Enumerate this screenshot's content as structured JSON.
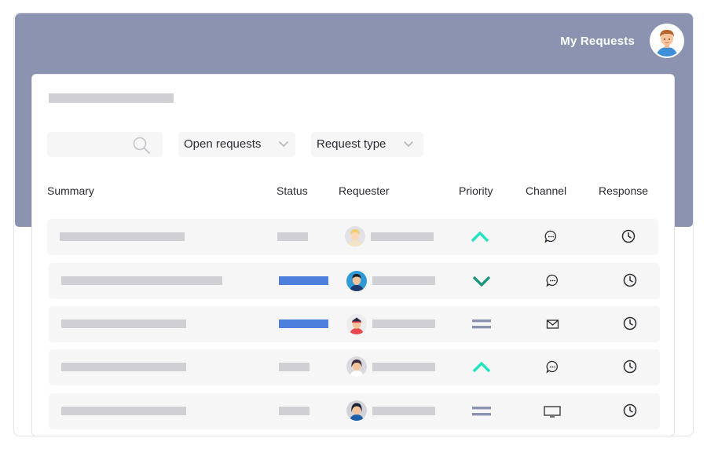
{
  "header": {
    "title": "My Requests"
  },
  "filters": {
    "open_requests": "Open requests",
    "request_type": "Request type"
  },
  "columns": {
    "summary": "Summary",
    "status": "Status",
    "requester": "Requester",
    "priority": "Priority",
    "channel": "Channel",
    "response": "Response"
  },
  "rows": [
    {
      "priority": "high",
      "channel": "chat-icon",
      "response": "clock-icon",
      "status_color": "#cfcfd4"
    },
    {
      "priority": "low",
      "channel": "chat-icon",
      "response": "clock-icon",
      "status_color": "#4c80dc"
    },
    {
      "priority": "medium",
      "channel": "email-icon",
      "response": "clock-icon",
      "status_color": "#4c80dc"
    },
    {
      "priority": "high",
      "channel": "chat-icon",
      "response": "clock-icon",
      "status_color": "#cfcfd4"
    },
    {
      "priority": "medium",
      "channel": "monitor-icon",
      "response": "clock-icon",
      "status_color": "#cfcfd4"
    }
  ],
  "colors": {
    "header": "#8b93b0",
    "priority_high": "#22e3c0",
    "priority_low": "#22957d",
    "priority_medium": "#8b93b0",
    "status_active": "#4c80dc"
  }
}
